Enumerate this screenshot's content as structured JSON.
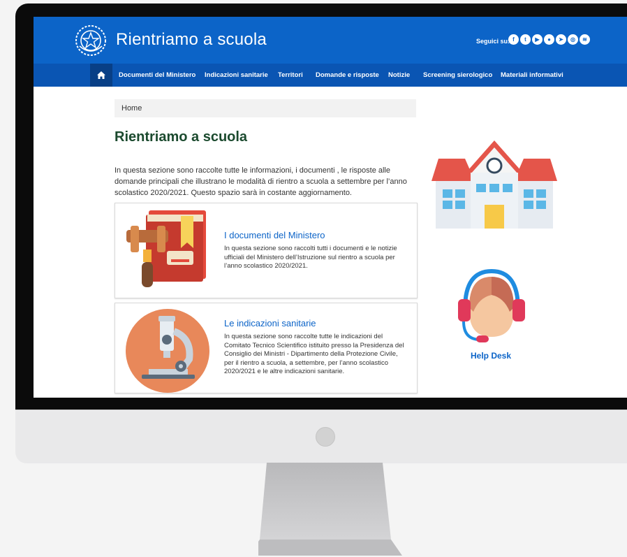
{
  "header": {
    "site_title": "Rientriamo a scuola",
    "social_label": "Seguici su:",
    "social_icons": [
      "facebook-icon",
      "twitter-icon",
      "youtube-icon",
      "flickr-icon",
      "telegram-icon",
      "instagram-icon",
      "spotify-icon"
    ]
  },
  "nav": {
    "items": [
      "Documenti del Ministero",
      "Indicazioni sanitarie",
      "Territori",
      "Domande e risposte",
      "Notizie",
      "Screening sierologico",
      "Materiali informativi"
    ]
  },
  "breadcrumb": {
    "home": "Home"
  },
  "page": {
    "title": "Rientriamo a scuola",
    "intro": "In questa sezione sono raccolte tutte le informazioni, i documenti , le risposte alle domande principali che illustrano le modalità di rientro a scuola a settembre per l’anno scolastico 2020/2021. Questo spazio sarà in costante aggiornamento."
  },
  "cards": [
    {
      "title": "I documenti del Ministero",
      "text": "In questa sezione sono raccolti tutti i documenti e le notizie ufficiali del Ministero dell’Istruzione sul rientro a scuola per l’anno scolastico 2020/2021."
    },
    {
      "title": "Le indicazioni sanitarie",
      "text": "In questa sezione sono raccolte tutte le indicazioni del Comitato Tecnico Scientifico istituito presso la Presidenza del Consiglio dei Ministri - Dipartimento della Protezione Civile, per il rientro a scuola, a settembre, per l’anno scolastico 2020/2021 e le altre indicazioni sanitarie."
    }
  ],
  "sidebar": {
    "helpdesk_label": "Help Desk"
  },
  "colors": {
    "primary": "#0c64c8",
    "nav": "#0a55b3",
    "title": "#1b4a2e"
  }
}
